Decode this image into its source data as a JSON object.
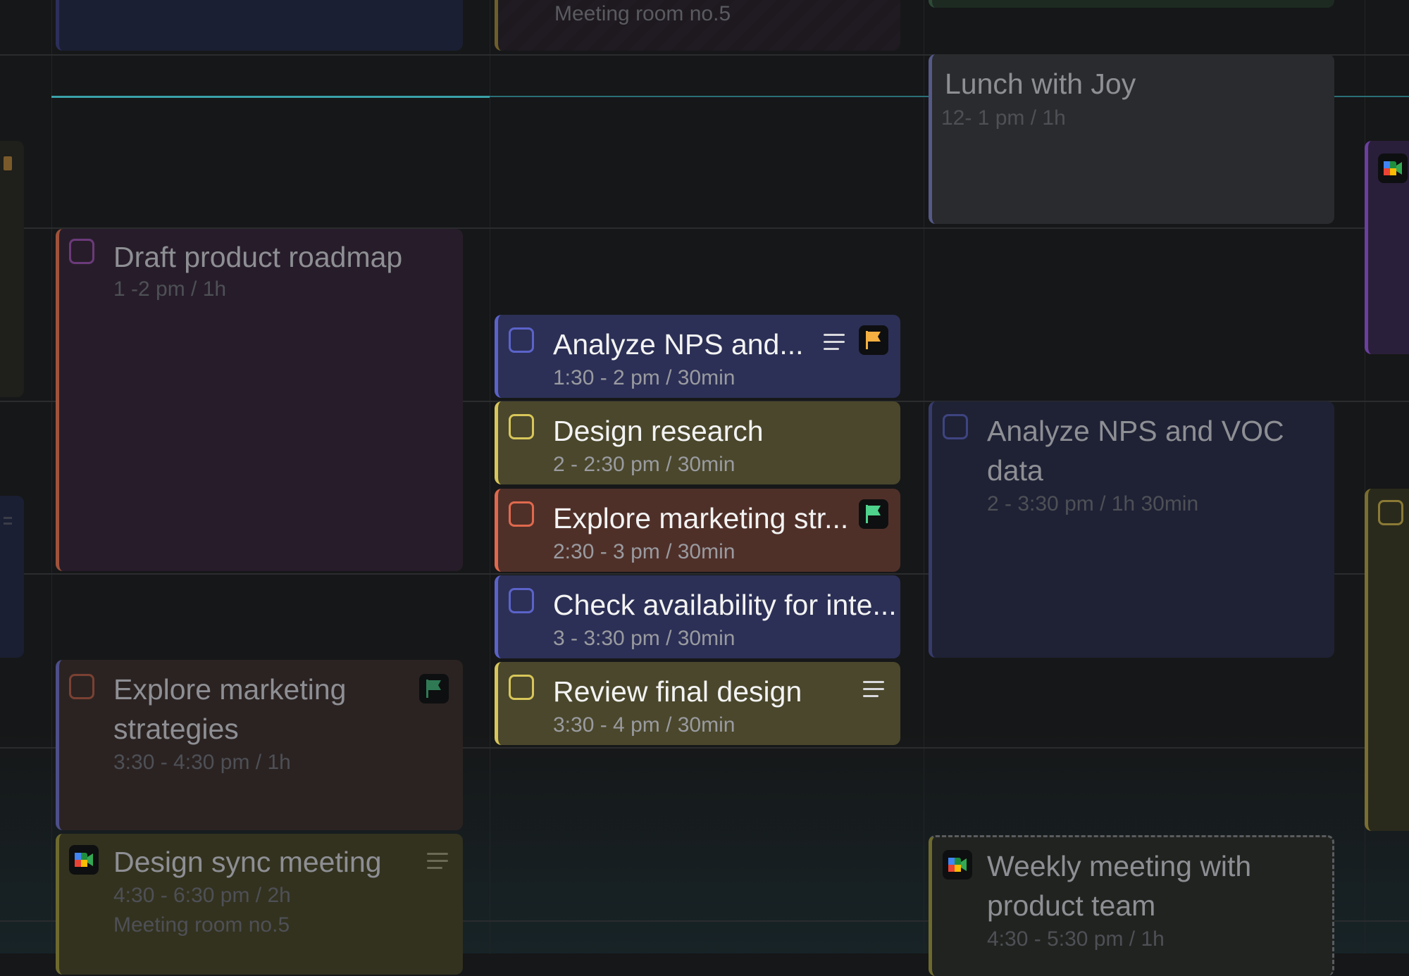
{
  "events": {
    "top_meeting": {
      "note": "Meeting room no.5"
    },
    "lunch": {
      "title": "Lunch with Joy",
      "time": "12- 1 pm / 1h"
    },
    "draft_roadmap": {
      "title": "Draft product roadmap",
      "time": "1 -2 pm / 1h"
    },
    "analyze_nps_short": {
      "title": "Analyze NPS and...",
      "time": "1:30 - 2 pm / 30min"
    },
    "design_research": {
      "title": "Design research",
      "time": "2 - 2:30 pm / 30min"
    },
    "explore_marketing_short": {
      "title": "Explore marketing str...",
      "time": "2:30 - 3 pm / 30min"
    },
    "check_availability": {
      "title": "Check availability for inte...",
      "time": "3 - 3:30 pm / 30min"
    },
    "review_final_design": {
      "title": "Review final design",
      "time": "3:30 - 4 pm / 30min"
    },
    "analyze_nps_full": {
      "title_line1": "Analyze NPS and VOC",
      "title_line2": "data",
      "time": "2 - 3:30 pm / 1h 30min"
    },
    "explore_marketing_full": {
      "title_line1": "Explore marketing",
      "title_line2": "strategies",
      "time": "3:30 - 4:30 pm / 1h"
    },
    "design_sync": {
      "title": "Design sync meeting",
      "time": "4:30 - 6:30 pm / 2h",
      "note": "Meeting room no.5"
    },
    "weekly_meeting": {
      "title_line1": "Weekly meeting with",
      "title_line2": "product team",
      "time": "4:30 - 5:30 pm / 1h"
    }
  },
  "colors": {
    "background": "#161718",
    "now_indicator": "#3aa1a9",
    "blue": "#5b63c9",
    "yellow": "#d8c65a",
    "orange": "#e0694d",
    "purple": "#7a3f8c",
    "flag_orange": "#f5b041",
    "flag_green": "#4ed28c"
  },
  "icons": {
    "flag": "flag-icon",
    "description": "description-lines-icon",
    "video_meeting": "google-meet-icon"
  }
}
